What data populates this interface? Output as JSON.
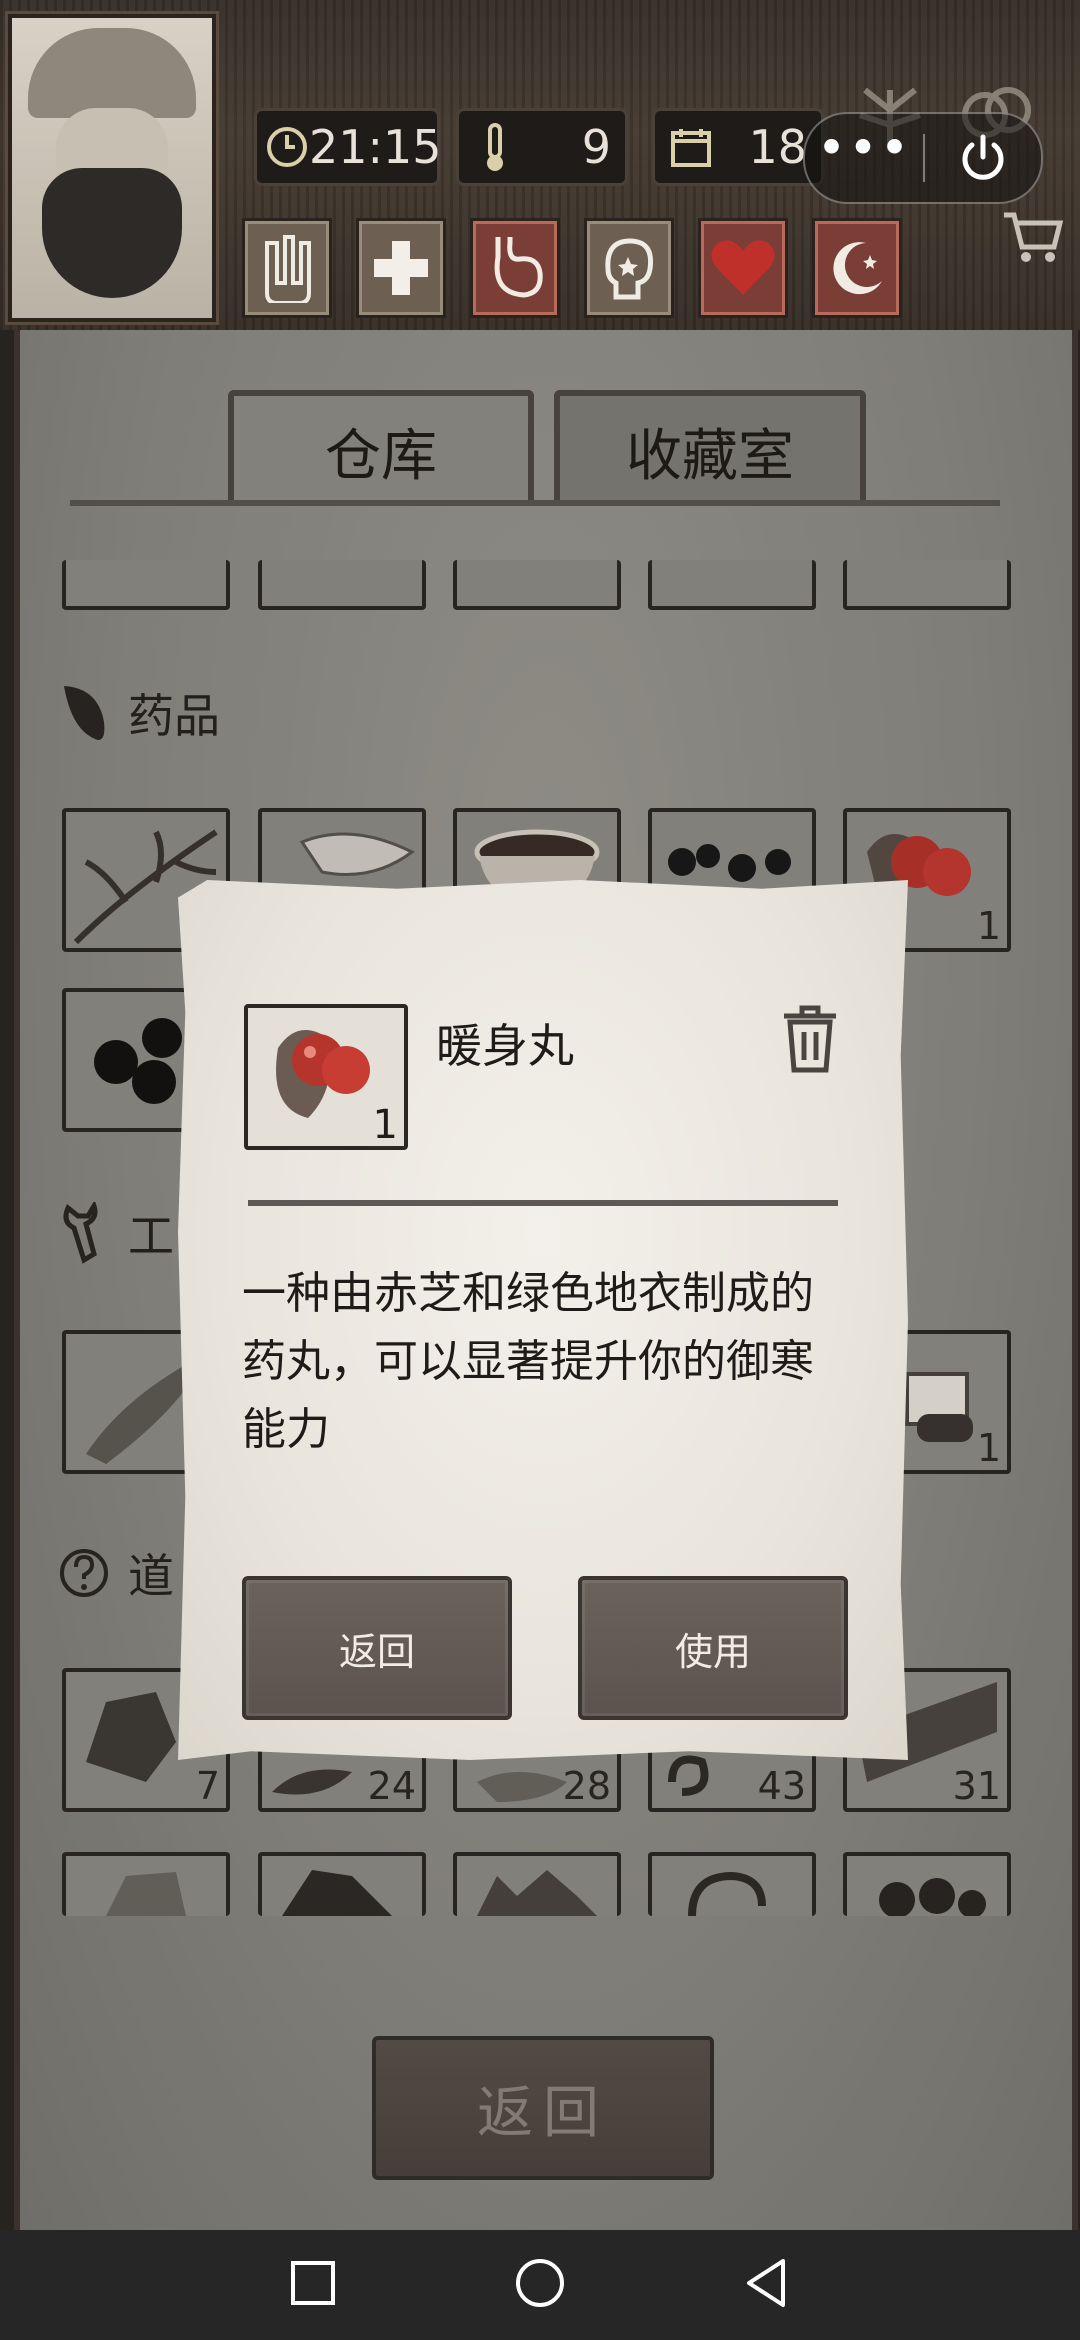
{
  "hud": {
    "time": "21:15",
    "temperature": "9",
    "day": "18"
  },
  "toolbar_icons": [
    "bandage-icon",
    "first-aid-icon",
    "stomach-icon",
    "mind-icon",
    "heart-icon",
    "sleep-icon"
  ],
  "tabs": {
    "warehouse": "仓库",
    "collection": "收藏室"
  },
  "inventory": {
    "medicine_label": "药品",
    "tools_label": "工",
    "misc_label": "道",
    "counts": {
      "medicine_row1_slot5": "1",
      "tools_row1_slot5": "1",
      "misc_row1": [
        "7",
        "24",
        "28",
        "43",
        "31"
      ]
    }
  },
  "dialog": {
    "item_name": "暖身丸",
    "item_count": "1",
    "description": "一种由赤芝和绿色地衣制成的药丸，可以显著提升你的御寒能力",
    "back_label": "返回",
    "use_label": "使用"
  },
  "bottom_back_label": "返回",
  "colors": {
    "panel": "#8a8882",
    "dialog": "#ece8e0",
    "button": "#5e5650",
    "heart": "#c0302a"
  }
}
